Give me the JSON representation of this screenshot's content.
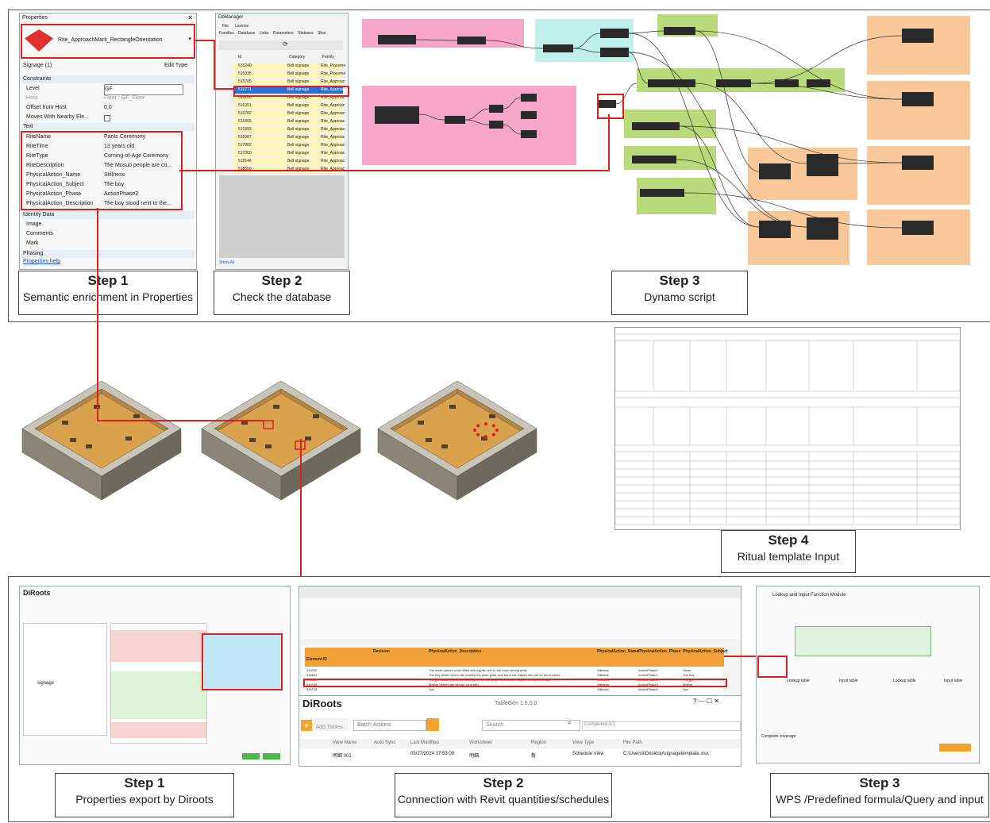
{
  "steps_top": [
    {
      "title": "Step 1",
      "subtitle": "Semantic enrichment in Properties"
    },
    {
      "title": "Step 2",
      "subtitle": "Check the database"
    },
    {
      "title": "Step 3",
      "subtitle": "Dynamo script"
    }
  ],
  "step4": {
    "title": "Step 4",
    "subtitle": "Ritual template Input"
  },
  "steps_bottom": [
    {
      "title": "Step 1",
      "subtitle": "Properties export by Diroots"
    },
    {
      "title": "Step 2",
      "subtitle": "Connection with Revit quantities/schedules"
    },
    {
      "title": "Step 3",
      "subtitle": "WPS /Predefined formula/Query and input"
    }
  ],
  "properties": {
    "header": "Properties",
    "family": "Rite_ApproachMark_RectangleOrientation",
    "type_select": "Signage (1)",
    "edit_type": "Edit Type",
    "sections": {
      "constraints": "Constraints",
      "text": "Text",
      "identity": "Identity Data",
      "phasing": "Phasing"
    },
    "constraints": [
      {
        "k": "Level",
        "v": "GF"
      },
      {
        "k": "Host",
        "v": "Floor : GF_Floor"
      },
      {
        "k": "Offset from Host",
        "v": "0.0"
      },
      {
        "k": "Moves With Nearby Ele...",
        "v": ""
      }
    ],
    "text_rows": [
      {
        "k": "RiteName",
        "v": "Pants Ceremony"
      },
      {
        "k": "RiteTime",
        "v": "13 years old"
      },
      {
        "k": "RiteType",
        "v": "Coming-of-Age Ceremony"
      },
      {
        "k": "RiteDescription",
        "v": "The Mosuo people are co..."
      },
      {
        "k": "PhysicalAction_Name",
        "v": "Stillness"
      },
      {
        "k": "PhysicalAction_Subject",
        "v": "The boy"
      },
      {
        "k": "PhysicalAction_Phase",
        "v": "ActionPhase2"
      },
      {
        "k": "PhysicalAction_Description",
        "v": "The boy stood next to the..."
      }
    ],
    "identity_rows": [
      {
        "k": "Image",
        "v": ""
      },
      {
        "k": "Comments",
        "v": ""
      },
      {
        "k": "Mark",
        "v": ""
      }
    ],
    "help_link": "Properties help"
  },
  "database": {
    "title": "DbManager",
    "menu": [
      "File",
      "License"
    ],
    "tabs": [
      "Families",
      "Database",
      "Links",
      "Parameters",
      "Statuses",
      "Shar"
    ],
    "columns": [
      "Id",
      "Category",
      "Family"
    ],
    "rows": [
      {
        "id": "515240",
        "cat": "Bell signage",
        "fam": "Rite_Placeme"
      },
      {
        "id": "515335",
        "cat": "Bell signage",
        "fam": "Rite_Placeme"
      },
      {
        "id": "515705",
        "cat": "Bell signage",
        "fam": "Rite_Approac"
      },
      {
        "id": "516771",
        "cat": "Bell signage",
        "fam": "Rite_Approac"
      },
      {
        "id": "516260",
        "cat": "Bell signage",
        "fam": "Rite_Approac"
      },
      {
        "id": "516351",
        "cat": "Bell signage",
        "fam": "Rite_Approac"
      },
      {
        "id": "516782",
        "cat": "Bell signage",
        "fam": "Rite_Approac"
      },
      {
        "id": "516665",
        "cat": "Bell signage",
        "fam": "Rite_Approac"
      },
      {
        "id": "516992",
        "cat": "Bell signage",
        "fam": "Rite_Approac"
      },
      {
        "id": "516987",
        "cat": "Bell signage",
        "fam": "Rite_Approac"
      },
      {
        "id": "517082",
        "cat": "Bell signage",
        "fam": "Rite_Approac"
      },
      {
        "id": "517060",
        "cat": "Bell signage",
        "fam": "Rite_Approac"
      },
      {
        "id": "518146",
        "cat": "Bell signage",
        "fam": "Rite_Approac"
      },
      {
        "id": "518550",
        "cat": "Bell signage",
        "fam": "Rite_Approac"
      }
    ],
    "footer": "Show All"
  },
  "diroots": {
    "logo": "DiRoots",
    "app": "TableGen 1.5.0.0",
    "signage": "signage",
    "add_tables": "Add Tables",
    "batch_actions": "Batch Actions",
    "search_placeholder": "Search",
    "completed": "Completed 0/1",
    "columns": [
      "View Name",
      "Auto Sync",
      "Last Modified",
      "Worksheet",
      "Region",
      "View Type",
      "File Path"
    ],
    "row": [
      "明细 001",
      "",
      "05/27/2024 17:53:00",
      "明细",
      "数",
      "Schedule View",
      "C:\\Users\\l\\Desktop\\signagetemplate.xlsx"
    ]
  },
  "excel": {
    "columns": [
      "Element ID",
      "Revision",
      "PhysicalAction_Description",
      "PhysicalAction_Name",
      "PhysicalAction_Phase",
      "PhysicalAction_Subject"
    ],
    "rows": [
      [
        "516700",
        "",
        "The uncle placed a belt fitted with pig fat next to the main central pillar.",
        "Stillness",
        "ActionPhase1",
        "Uncle"
      ],
      [
        "516561",
        "",
        "The boy stood next to the seat by the male pillar, and his uncle helped him put on his trousers.",
        "Stillness",
        "ActionPhase2",
        "The boy"
      ],
      [
        "516590",
        "",
        "The girl stood next to the seat by the female pillar. Her mother helped her put on a skirt.",
        "Stillness",
        "ActionPhase2",
        "The girl"
      ],
      [
        "516765",
        "",
        "Mother helped the girl put on a skirt.",
        "Stillness",
        "ActionPhase3",
        "Mother"
      ],
      [
        "516726",
        "",
        "Null",
        "Stillness",
        "ActionPhase3",
        "Null"
      ]
    ]
  },
  "wps": {
    "title": "Lookup and Input Function Module",
    "lookup_label": "Lookup table",
    "input_label": "Input table",
    "complete_label": "Complete coverage"
  },
  "colors": {
    "highlight": "#e02020",
    "dynamo_pink": "#f6a7c8",
    "dynamo_cyan": "#bff0ea",
    "dynamo_green": "#b9d97a",
    "dynamo_orange": "#f8c79a",
    "excel_header": "#f3a23a",
    "wood": "#d9a24d"
  }
}
